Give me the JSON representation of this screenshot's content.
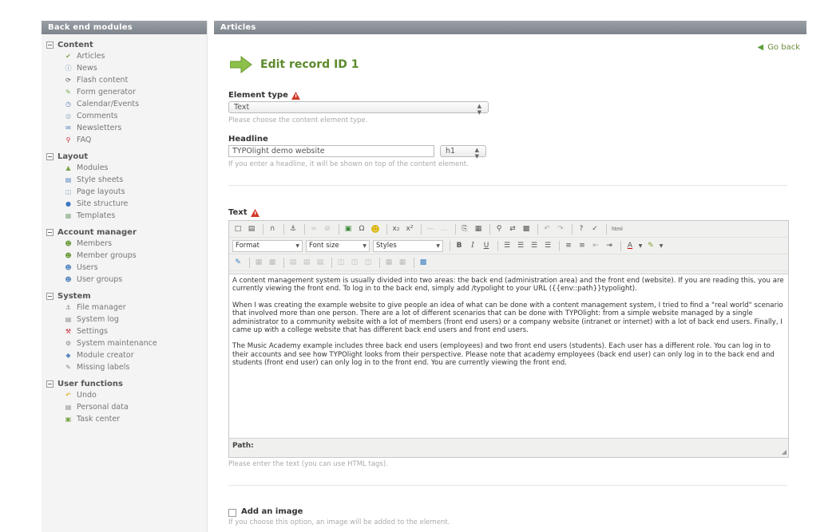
{
  "sidebar": {
    "header": "Back end modules",
    "groups": [
      {
        "title": "Content",
        "items": [
          {
            "label": "Articles",
            "icon": "articles-icon"
          },
          {
            "label": "News",
            "icon": "news-icon"
          },
          {
            "label": "Flash content",
            "icon": "flash-icon"
          },
          {
            "label": "Form generator",
            "icon": "form-icon"
          },
          {
            "label": "Calendar/Events",
            "icon": "calendar-icon"
          },
          {
            "label": "Comments",
            "icon": "comments-icon"
          },
          {
            "label": "Newsletters",
            "icon": "newsletter-icon"
          },
          {
            "label": "FAQ",
            "icon": "faq-icon"
          }
        ]
      },
      {
        "title": "Layout",
        "items": [
          {
            "label": "Modules",
            "icon": "modules-icon"
          },
          {
            "label": "Style sheets",
            "icon": "stylesheet-icon"
          },
          {
            "label": "Page layouts",
            "icon": "layout-icon"
          },
          {
            "label": "Site structure",
            "icon": "globe-icon"
          },
          {
            "label": "Templates",
            "icon": "template-icon"
          }
        ]
      },
      {
        "title": "Account manager",
        "items": [
          {
            "label": "Members",
            "icon": "member-icon"
          },
          {
            "label": "Member groups",
            "icon": "member-group-icon"
          },
          {
            "label": "Users",
            "icon": "user-icon"
          },
          {
            "label": "User groups",
            "icon": "user-group-icon"
          }
        ]
      },
      {
        "title": "System",
        "items": [
          {
            "label": "File manager",
            "icon": "file-manager-icon"
          },
          {
            "label": "System log",
            "icon": "log-icon"
          },
          {
            "label": "Settings",
            "icon": "settings-icon"
          },
          {
            "label": "System maintenance",
            "icon": "maintenance-icon"
          },
          {
            "label": "Module creator",
            "icon": "module-creator-icon"
          },
          {
            "label": "Missing labels",
            "icon": "labels-icon"
          }
        ]
      },
      {
        "title": "User functions",
        "items": [
          {
            "label": "Undo",
            "icon": "undo-icon"
          },
          {
            "label": "Personal data",
            "icon": "personal-data-icon"
          },
          {
            "label": "Task center",
            "icon": "task-icon"
          }
        ]
      }
    ]
  },
  "main": {
    "header": "Articles",
    "go_back": "Go back",
    "edit_title": "Edit record ID 1",
    "element_type": {
      "label": "Element type",
      "value": "Text",
      "help": "Please choose the content element type."
    },
    "headline": {
      "label": "Headline",
      "value": "TYPOlight demo website",
      "unit": "h1",
      "help": "If you enter a headline, it will be shown on top of the content element."
    },
    "text": {
      "label": "Text",
      "toolbar": {
        "format": "Format",
        "font_size": "Font size",
        "styles": "Styles"
      },
      "paragraphs": [
        "A content management system is usually divided into two areas: the back end (administration area) and the front end (website). If you are reading this, you are currently viewing the front end. To log in to the back end, simply add /typolight to your URL ({{env::path}}typolight).",
        "When I was creating the example website to give people an idea of what can be done with a content management system, I tried to find a \"real world\" scenario that involved more than one person. There are a lot of different scenarios that can be done with TYPOlight: from a simple website managed by a single administrator to a community website with a lot of members (front end users) or a company website (intranet or internet) with a lot of back end users. Finally, I came up with a college website that has different back end users and front end users.",
        "The Music Academy example includes three back end users (employees) and two front end users (students). Each user has a different role. You can log in to their accounts and see how TYPOlight looks from their perspective. Please note that academy employees (back end user) can only log in to the back end and students (front end user) can only log in to the front end. You are currently viewing the front end."
      ],
      "path_label": "Path:",
      "help": "Please enter the text (you can use HTML tags)."
    },
    "add_image": {
      "label": "Add an image",
      "help": "If you choose this option, an image will be added to the element."
    }
  },
  "colors": {
    "header_bg": "#858b92",
    "title_green": "#5d8a2c",
    "warn_red": "#d23a2a"
  }
}
